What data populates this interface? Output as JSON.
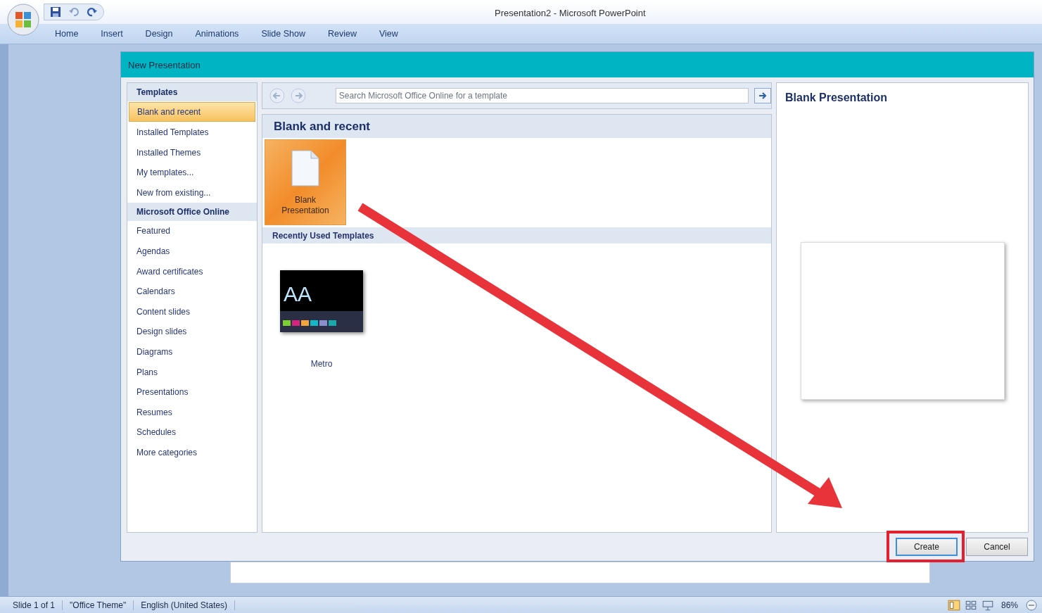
{
  "window": {
    "title": "Presentation2 - Microsoft PowerPoint"
  },
  "ribbon_tabs": [
    {
      "label": "Home",
      "selected": false
    },
    {
      "label": "Insert",
      "selected": false
    },
    {
      "label": "Design",
      "selected": false
    },
    {
      "label": "Animations",
      "selected": false
    },
    {
      "label": "Slide Show",
      "selected": false
    },
    {
      "label": "Review",
      "selected": false
    },
    {
      "label": "View",
      "selected": false
    }
  ],
  "dialog": {
    "title": "New Presentation",
    "sidebar": {
      "items": [
        {
          "label": "Templates",
          "kind": "header",
          "selected": false
        },
        {
          "label": "Blank and recent",
          "kind": "item",
          "selected": true
        },
        {
          "label": "Installed Templates",
          "kind": "item",
          "selected": false
        },
        {
          "label": "Installed Themes",
          "kind": "item",
          "selected": false
        },
        {
          "label": "My templates...",
          "kind": "item",
          "selected": false
        },
        {
          "label": "New from existing...",
          "kind": "item",
          "selected": false
        },
        {
          "label": "Microsoft Office Online",
          "kind": "header",
          "selected": false
        },
        {
          "label": "Featured",
          "kind": "item",
          "selected": false
        },
        {
          "label": "Agendas",
          "kind": "item",
          "selected": false
        },
        {
          "label": "Award certificates",
          "kind": "item",
          "selected": false
        },
        {
          "label": "Calendars",
          "kind": "item",
          "selected": false
        },
        {
          "label": "Content slides",
          "kind": "item",
          "selected": false
        },
        {
          "label": "Design slides",
          "kind": "item",
          "selected": false
        },
        {
          "label": "Diagrams",
          "kind": "item",
          "selected": false
        },
        {
          "label": "Plans",
          "kind": "item",
          "selected": false
        },
        {
          "label": "Presentations",
          "kind": "item",
          "selected": false
        },
        {
          "label": "Resumes",
          "kind": "item",
          "selected": false
        },
        {
          "label": "Schedules",
          "kind": "item",
          "selected": false
        },
        {
          "label": "More categories",
          "kind": "item",
          "selected": false
        }
      ]
    },
    "search": {
      "placeholder": "Search Microsoft Office Online for a template"
    },
    "section_title": "Blank and recent",
    "blank_tile": {
      "label": "Blank Presentation",
      "selected": true
    },
    "recent_heading": "Recently Used Templates",
    "recent_templates": [
      {
        "name": "Metro",
        "thumbnail_text": "AA"
      }
    ],
    "preview": {
      "title": "Blank Presentation"
    },
    "buttons": [
      {
        "label": "Create",
        "highlighted": true
      },
      {
        "label": "Cancel",
        "highlighted": false
      }
    ]
  },
  "status_bar": {
    "items": [
      "Slide 1 of 1",
      "\"Office Theme\"",
      "English (United States)"
    ],
    "zoom": "86%"
  }
}
